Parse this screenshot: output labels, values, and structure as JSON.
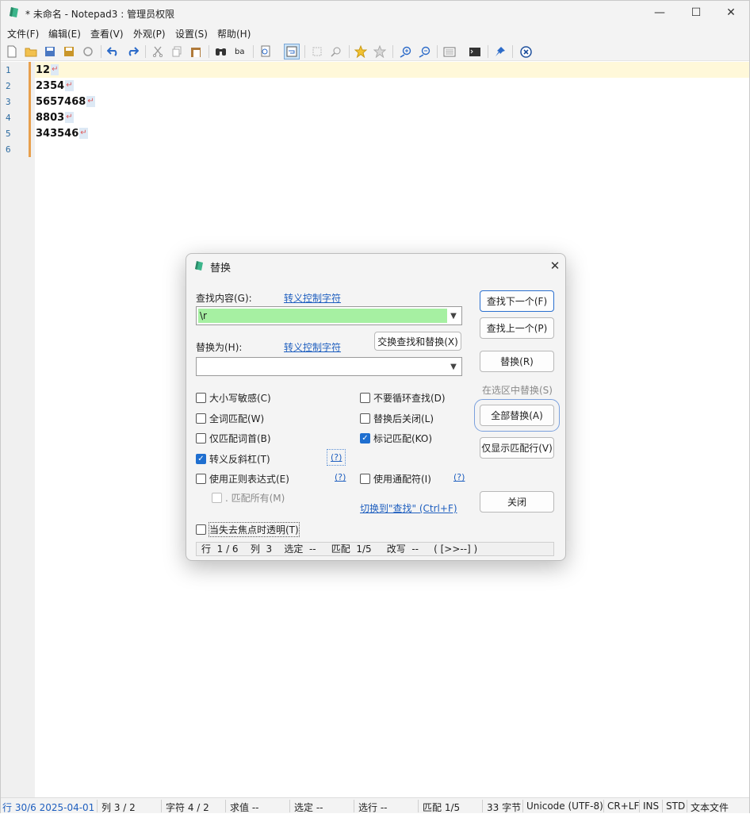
{
  "window": {
    "title": "* 未命名 - Notepad3 : 管理员权限",
    "minimize": "—",
    "maximize": "☐",
    "close": "✕"
  },
  "menu": [
    "文件(F)",
    "编辑(E)",
    "查看(V)",
    "外观(P)",
    "设置(S)",
    "帮助(H)"
  ],
  "toolbar": {
    "icons": [
      "new-file-icon",
      "open-folder-icon",
      "save-icon",
      "save-as-icon",
      "revert-icon",
      "undo-icon",
      "redo-icon",
      "cut-icon",
      "copy-icon",
      "paste-icon",
      "find-icon",
      "replace-icon",
      "zoom-find-icon",
      "word-wrap-icon",
      "goto-icon",
      "search-in-files-icon",
      "favorite-add-icon",
      "favorite-icon",
      "zoom-in-icon",
      "zoom-out-icon",
      "view-lines-icon",
      "console-icon",
      "pin-icon",
      "exit-icon"
    ]
  },
  "editor": {
    "line_numbers": [
      "1",
      "2",
      "3",
      "4",
      "5",
      "6"
    ],
    "lines": [
      "12",
      "2354",
      "5657468",
      "8803",
      "343546",
      ""
    ],
    "eol_marker": "↵",
    "current_line_color": "#fff8d9"
  },
  "dialog": {
    "title": "替换",
    "find_label": "查找内容(G):",
    "find_escape_link": "转义控制字符",
    "find_value": "\\r",
    "replace_label": "替换为(H):",
    "replace_escape_link": "转义控制字符",
    "replace_value": "",
    "swap_button": "交换查找和替换(X)",
    "buttons": {
      "find_next": "查找下一个(F)",
      "find_prev": "查找上一个(P)",
      "replace": "替换(R)",
      "replace_in_selection": "在选区中替换(S)",
      "replace_all": "全部替换(A)",
      "show_matching_lines": "仅显示匹配行(V)",
      "close": "关闭"
    },
    "options": {
      "match_case": {
        "label": "大小写敏感(C)",
        "checked": false
      },
      "whole_word": {
        "label": "全词匹配(W)",
        "checked": false
      },
      "word_start": {
        "label": "仅匹配词首(B)",
        "checked": false
      },
      "escape_backslash": {
        "label": "转义反斜杠(T)",
        "checked": true
      },
      "regex": {
        "label": "使用正则表达式(E)",
        "checked": false
      },
      "dot_all": {
        "label": ". 匹配所有(M)",
        "checked": false
      },
      "no_wrap": {
        "label": "不要循环查找(D)",
        "checked": false
      },
      "close_after_replace": {
        "label": "替换后关闭(L)",
        "checked": false
      },
      "mark_matches": {
        "label": "标记匹配(KO)",
        "checked": true
      },
      "wildcards": {
        "label": "使用通配符(I)",
        "checked": false
      },
      "transparent": {
        "label": "当失去焦点时透明(T)",
        "checked": false
      }
    },
    "help_label": "(?)",
    "switch_link": "切换到\"查找\" (Ctrl+F)",
    "status": "行  1 / 6    列  3    选定  --     匹配  1/5     改写  --     ( [>>--] )"
  },
  "statusbar": {
    "position": "行 30/6 2025-04-01",
    "column": "列  3 / 2",
    "chars": "字符  4 / 2",
    "sum": "求值  --",
    "selection": "选定  --",
    "selected_lines": "选行  --",
    "matches": "匹配  1/5",
    "bytes": "33 字节",
    "encoding": "Unicode (UTF-8)",
    "eol": "CR+LF",
    "ins": "INS",
    "std": "STD",
    "lexer": "文本文件"
  }
}
